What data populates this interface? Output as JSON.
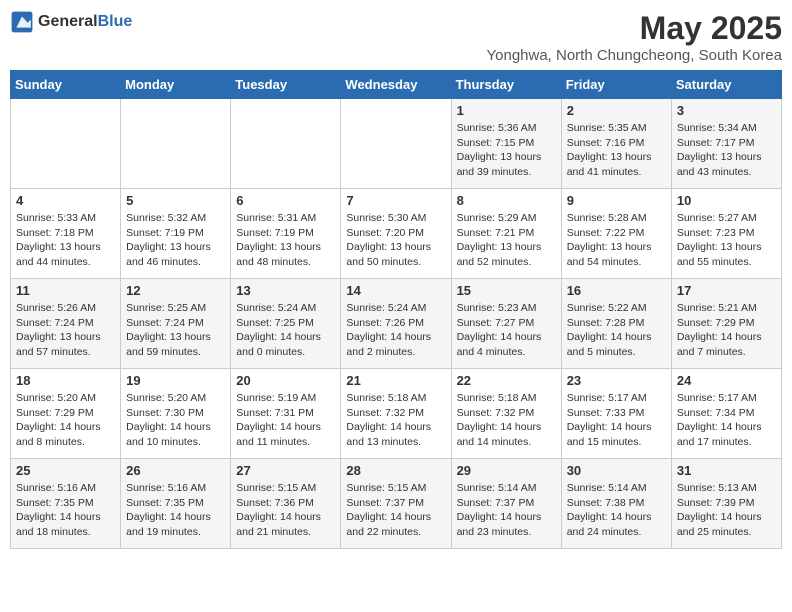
{
  "logo": {
    "general": "General",
    "blue": "Blue"
  },
  "title": "May 2025",
  "subtitle": "Yonghwa, North Chungcheong, South Korea",
  "days_of_week": [
    "Sunday",
    "Monday",
    "Tuesday",
    "Wednesday",
    "Thursday",
    "Friday",
    "Saturday"
  ],
  "weeks": [
    [
      {
        "day": "",
        "info": ""
      },
      {
        "day": "",
        "info": ""
      },
      {
        "day": "",
        "info": ""
      },
      {
        "day": "",
        "info": ""
      },
      {
        "day": "1",
        "info": "Sunrise: 5:36 AM\nSunset: 7:15 PM\nDaylight: 13 hours\nand 39 minutes."
      },
      {
        "day": "2",
        "info": "Sunrise: 5:35 AM\nSunset: 7:16 PM\nDaylight: 13 hours\nand 41 minutes."
      },
      {
        "day": "3",
        "info": "Sunrise: 5:34 AM\nSunset: 7:17 PM\nDaylight: 13 hours\nand 43 minutes."
      }
    ],
    [
      {
        "day": "4",
        "info": "Sunrise: 5:33 AM\nSunset: 7:18 PM\nDaylight: 13 hours\nand 44 minutes."
      },
      {
        "day": "5",
        "info": "Sunrise: 5:32 AM\nSunset: 7:19 PM\nDaylight: 13 hours\nand 46 minutes."
      },
      {
        "day": "6",
        "info": "Sunrise: 5:31 AM\nSunset: 7:19 PM\nDaylight: 13 hours\nand 48 minutes."
      },
      {
        "day": "7",
        "info": "Sunrise: 5:30 AM\nSunset: 7:20 PM\nDaylight: 13 hours\nand 50 minutes."
      },
      {
        "day": "8",
        "info": "Sunrise: 5:29 AM\nSunset: 7:21 PM\nDaylight: 13 hours\nand 52 minutes."
      },
      {
        "day": "9",
        "info": "Sunrise: 5:28 AM\nSunset: 7:22 PM\nDaylight: 13 hours\nand 54 minutes."
      },
      {
        "day": "10",
        "info": "Sunrise: 5:27 AM\nSunset: 7:23 PM\nDaylight: 13 hours\nand 55 minutes."
      }
    ],
    [
      {
        "day": "11",
        "info": "Sunrise: 5:26 AM\nSunset: 7:24 PM\nDaylight: 13 hours\nand 57 minutes."
      },
      {
        "day": "12",
        "info": "Sunrise: 5:25 AM\nSunset: 7:24 PM\nDaylight: 13 hours\nand 59 minutes."
      },
      {
        "day": "13",
        "info": "Sunrise: 5:24 AM\nSunset: 7:25 PM\nDaylight: 14 hours\nand 0 minutes."
      },
      {
        "day": "14",
        "info": "Sunrise: 5:24 AM\nSunset: 7:26 PM\nDaylight: 14 hours\nand 2 minutes."
      },
      {
        "day": "15",
        "info": "Sunrise: 5:23 AM\nSunset: 7:27 PM\nDaylight: 14 hours\nand 4 minutes."
      },
      {
        "day": "16",
        "info": "Sunrise: 5:22 AM\nSunset: 7:28 PM\nDaylight: 14 hours\nand 5 minutes."
      },
      {
        "day": "17",
        "info": "Sunrise: 5:21 AM\nSunset: 7:29 PM\nDaylight: 14 hours\nand 7 minutes."
      }
    ],
    [
      {
        "day": "18",
        "info": "Sunrise: 5:20 AM\nSunset: 7:29 PM\nDaylight: 14 hours\nand 8 minutes."
      },
      {
        "day": "19",
        "info": "Sunrise: 5:20 AM\nSunset: 7:30 PM\nDaylight: 14 hours\nand 10 minutes."
      },
      {
        "day": "20",
        "info": "Sunrise: 5:19 AM\nSunset: 7:31 PM\nDaylight: 14 hours\nand 11 minutes."
      },
      {
        "day": "21",
        "info": "Sunrise: 5:18 AM\nSunset: 7:32 PM\nDaylight: 14 hours\nand 13 minutes."
      },
      {
        "day": "22",
        "info": "Sunrise: 5:18 AM\nSunset: 7:32 PM\nDaylight: 14 hours\nand 14 minutes."
      },
      {
        "day": "23",
        "info": "Sunrise: 5:17 AM\nSunset: 7:33 PM\nDaylight: 14 hours\nand 15 minutes."
      },
      {
        "day": "24",
        "info": "Sunrise: 5:17 AM\nSunset: 7:34 PM\nDaylight: 14 hours\nand 17 minutes."
      }
    ],
    [
      {
        "day": "25",
        "info": "Sunrise: 5:16 AM\nSunset: 7:35 PM\nDaylight: 14 hours\nand 18 minutes."
      },
      {
        "day": "26",
        "info": "Sunrise: 5:16 AM\nSunset: 7:35 PM\nDaylight: 14 hours\nand 19 minutes."
      },
      {
        "day": "27",
        "info": "Sunrise: 5:15 AM\nSunset: 7:36 PM\nDaylight: 14 hours\nand 21 minutes."
      },
      {
        "day": "28",
        "info": "Sunrise: 5:15 AM\nSunset: 7:37 PM\nDaylight: 14 hours\nand 22 minutes."
      },
      {
        "day": "29",
        "info": "Sunrise: 5:14 AM\nSunset: 7:37 PM\nDaylight: 14 hours\nand 23 minutes."
      },
      {
        "day": "30",
        "info": "Sunrise: 5:14 AM\nSunset: 7:38 PM\nDaylight: 14 hours\nand 24 minutes."
      },
      {
        "day": "31",
        "info": "Sunrise: 5:13 AM\nSunset: 7:39 PM\nDaylight: 14 hours\nand 25 minutes."
      }
    ]
  ]
}
